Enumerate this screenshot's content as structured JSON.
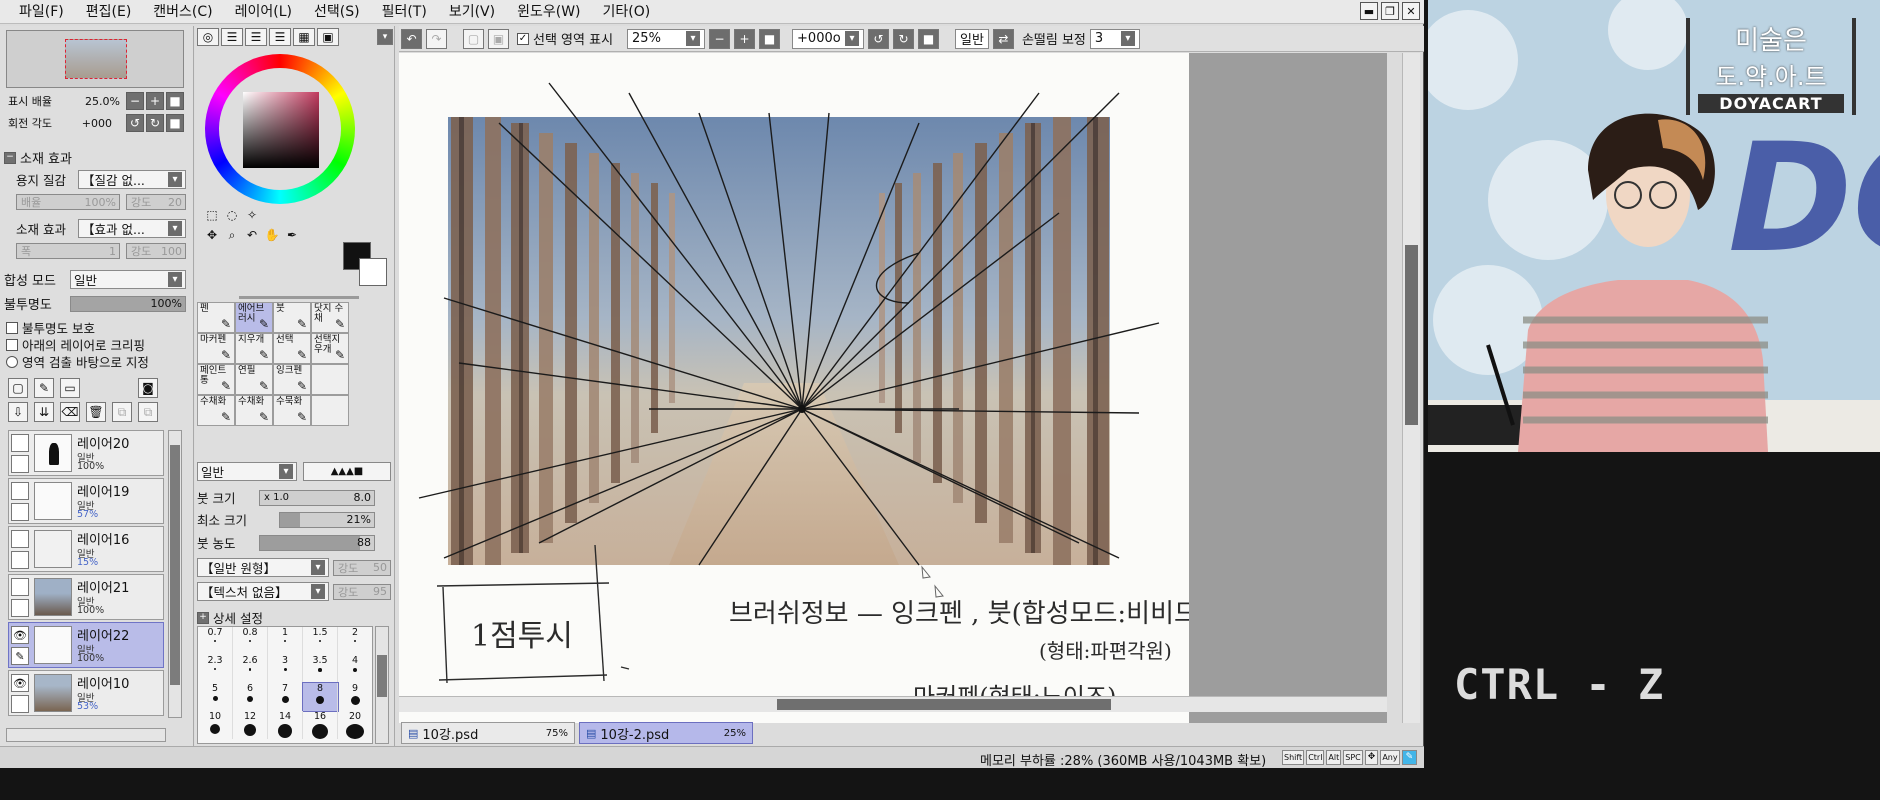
{
  "menubar": {
    "items": [
      "파일(F)",
      "편집(E)",
      "캔버스(C)",
      "레이어(L)",
      "선택(S)",
      "필터(T)",
      "보기(V)",
      "윈도우(W)",
      "기타(O)"
    ]
  },
  "window_controls": {
    "min": "▬",
    "max": "❐",
    "close": "✕"
  },
  "navigator": {
    "zoom_label": "표시 배율",
    "zoom_value": "25.0%",
    "rotate_label": "회전 각도",
    "rotate_value": "+000"
  },
  "texture": {
    "section_title": "소재 효과",
    "paper_label": "용지 질감",
    "paper_value": "【질감 없...",
    "scale_label": "배율",
    "scale_value": "100%",
    "strength_label": "강도",
    "strength_value": "20",
    "effect_label": "소재 효과",
    "effect_value": "【효과 없...",
    "width_label": "폭",
    "width_value": "1",
    "strength2_label": "강도",
    "strength2_value": "100"
  },
  "layer_props": {
    "blend_label": "합성 모드",
    "blend_value": "일반",
    "opacity_label": "불투명도",
    "opacity_value": "100%",
    "options": [
      "불투명도 보호",
      "아래의 레이어로 크리핑",
      "영역 검출 바탕으로 지정"
    ]
  },
  "layers": [
    {
      "name": "레이어20",
      "blend": "일반",
      "opacity": "100%",
      "selected": false
    },
    {
      "name": "레이어19",
      "blend": "일반",
      "opacity": "57%",
      "selected": false
    },
    {
      "name": "레이어16",
      "blend": "일반",
      "opacity": "15%",
      "selected": false
    },
    {
      "name": "레이어21",
      "blend": "일반",
      "opacity": "100%",
      "selected": false
    },
    {
      "name": "레이어22",
      "blend": "일반",
      "opacity": "100%",
      "selected": true
    },
    {
      "name": "레이어10",
      "blend": "일반",
      "opacity": "53%",
      "selected": false
    }
  ],
  "tools": {
    "grid": [
      [
        "펜",
        "에어브러시",
        "붓",
        "닷지 수채"
      ],
      [
        "마커펜",
        "지우개",
        "선택",
        "선택지우개"
      ],
      [
        "페인트통",
        "연필",
        "잉크펜",
        ""
      ],
      [
        "수채화",
        "수채화",
        "수묵화",
        ""
      ]
    ]
  },
  "brush": {
    "mode_value": "일반",
    "size_label": "붓 크기",
    "size_mult": "x 1.0",
    "size_value": "8.0",
    "minsize_label": "최소 크기",
    "minsize_value": "21%",
    "minsize_pct": 21,
    "density_label": "붓 농도",
    "density_value": "88",
    "density_pct": 88,
    "shape_value": "【일반 원형】",
    "shape_strength_label": "강도",
    "shape_strength_value": "50",
    "texture_value": "【텍스처 없음】",
    "texture_strength_label": "강도",
    "texture_strength_value": "95",
    "detail_label": "상세 설정",
    "sizes": [
      "0.7",
      "0.8",
      "1",
      "1.5",
      "2",
      "2.3",
      "2.6",
      "3",
      "3.5",
      "4",
      "5",
      "6",
      "7",
      "8",
      "9",
      "10",
      "12",
      "14",
      "16",
      "20"
    ]
  },
  "canvas_toolbar": {
    "selection_label": "선택 영역 표시",
    "zoom": "25%",
    "rotation": "+000ο",
    "mode": "일반",
    "stabilizer_label": "손떨림 보정",
    "stabilizer_value": "3"
  },
  "drawing": {
    "note1": "1점투시",
    "note2": "브러쉬정보 — 잉크펜 , 붓(합성모드:비비드)",
    "note3": "(형태:파편각원)",
    "note4": "마커펜(형태:노이즈)"
  },
  "doc_tabs": [
    {
      "name": "10강.psd",
      "zoom": "75%",
      "active": false
    },
    {
      "name": "10강-2.psd",
      "zoom": "25%",
      "active": true
    }
  ],
  "status": {
    "memory": "메모리 부하률 :28% (360MB 사용/1043MB 확보)",
    "keys": [
      "Shift",
      "Ctrl",
      "Alt",
      "SPC",
      "Any"
    ]
  },
  "overlay": {
    "logo_line1": "미술은",
    "logo_line2": "도.약.아.트",
    "logo_line3": "DOYACART",
    "shortcut": "CTRL - Z"
  },
  "colors": {
    "accent": "#b5b8ea",
    "selected_border": "#6c6fc0"
  }
}
